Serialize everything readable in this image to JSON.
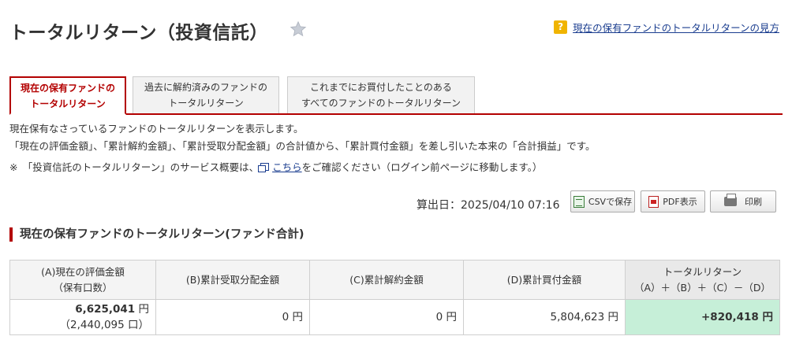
{
  "header": {
    "title": "トータルリターン（投資信託）",
    "help_link": "現在の保有ファンドのトータルリターンの見方",
    "help_icon_text": "?"
  },
  "tabs": [
    {
      "line1": "現在の保有ファンドの",
      "line2": "トータルリターン",
      "active": true
    },
    {
      "line1": "過去に解約済みのファンドの",
      "line2": "トータルリターン",
      "active": false
    },
    {
      "line1": "これまでにお買付したことのある",
      "line2": "すべてのファンドのトータルリターン",
      "active": false
    }
  ],
  "description": {
    "line1": "現在保有なさっているファンドのトータルリターンを表示します。",
    "line2": "「現在の評価金額」、「累計解約金額」、「累計受取分配金額」の合計値から、「累計買付金額」を差し引いた本来の「合計損益」です。",
    "line3_prefix": "※　「投資信託のトータルリターン」のサービス概要は、",
    "line3_link": "こちら",
    "line3_suffix": "をご確認ください（ログイン前ページに移動します。）"
  },
  "toolbar": {
    "calc_date": "算出日：2025/04/10 07:16",
    "csv_label": "CSVで保存",
    "pdf_label": "PDF表示",
    "print_label": "印刷"
  },
  "section_title": "現在の保有ファンドのトータルリターン(ファンド合計)",
  "table": {
    "headers": [
      {
        "line1": "(A)現在の評価金額",
        "line2": "（保有口数）"
      },
      {
        "line1": "(B)累計受取分配金額",
        "line2": ""
      },
      {
        "line1": "(C)累計解約金額",
        "line2": ""
      },
      {
        "line1": "(D)累計買付金額",
        "line2": ""
      },
      {
        "line1": "トータルリターン",
        "line2": "（A）＋（B）＋（C）－（D）"
      }
    ],
    "row": {
      "a_value": "6,625,041",
      "a_unit": " 円",
      "a_units_held": "（2,440,095 口）",
      "b_value": "0 円",
      "c_value": "0 円",
      "d_value": "5,804,623 円",
      "total_value": "+820,418 円"
    }
  },
  "colors": {
    "accent": "#b30000",
    "link": "#1a3d8f",
    "positive": "#e60012",
    "total_bg": "#c6efd8"
  }
}
